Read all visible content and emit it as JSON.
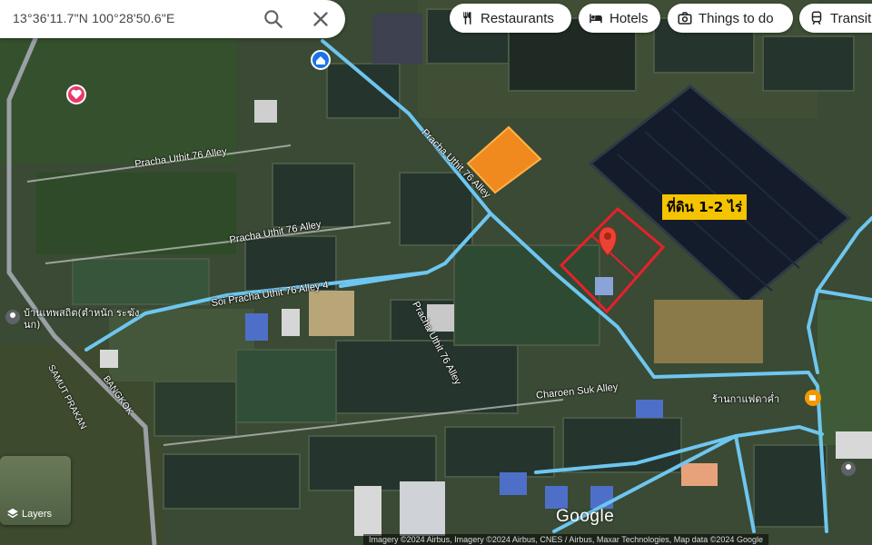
{
  "search": {
    "coords": "13°36'11.7\"N 100°28'50.6\"E"
  },
  "chips": [
    {
      "label": "Restaurants",
      "icon": "fork-knife-icon"
    },
    {
      "label": "Hotels",
      "icon": "bed-icon"
    },
    {
      "label": "Things to do",
      "icon": "camera-icon"
    },
    {
      "label": "Transit",
      "icon": "train-icon"
    }
  ],
  "map": {
    "land_label": "ที่ดิน 1-2 ไร่",
    "roads": [
      {
        "label": "Pracha Uthit 76 Alley"
      },
      {
        "label": "Pracha Uthit 76 Alley"
      },
      {
        "label": "Soi Pracha Uthit 76 Alley 4"
      },
      {
        "label": "Pracha Uthit 76 Alley"
      },
      {
        "label": "Charoen Suk Alley"
      },
      {
        "label": "BANGKOK"
      },
      {
        "label": "SAMUT PRAKAN"
      },
      {
        "label": "Pracha Uthit 76 Alley"
      }
    ],
    "pois": [
      {
        "label": "บ้านเทพสถิต(ตำหนัก ระฆังนก)"
      },
      {
        "label": "ร้านกาแฟดาค่ำ"
      }
    ],
    "colors": {
      "road": "#6ec6f0",
      "marker": "#ea4335",
      "land_label_bg": "#f4c400",
      "boundary": "#e8202a"
    }
  },
  "layers": {
    "label": "Layers"
  },
  "branding": {
    "logo": "Google"
  },
  "attribution": "Imagery ©2024 Airbus, Imagery ©2024 Airbus, CNES / Airbus, Maxar Technologies, Map data ©2024 Google"
}
